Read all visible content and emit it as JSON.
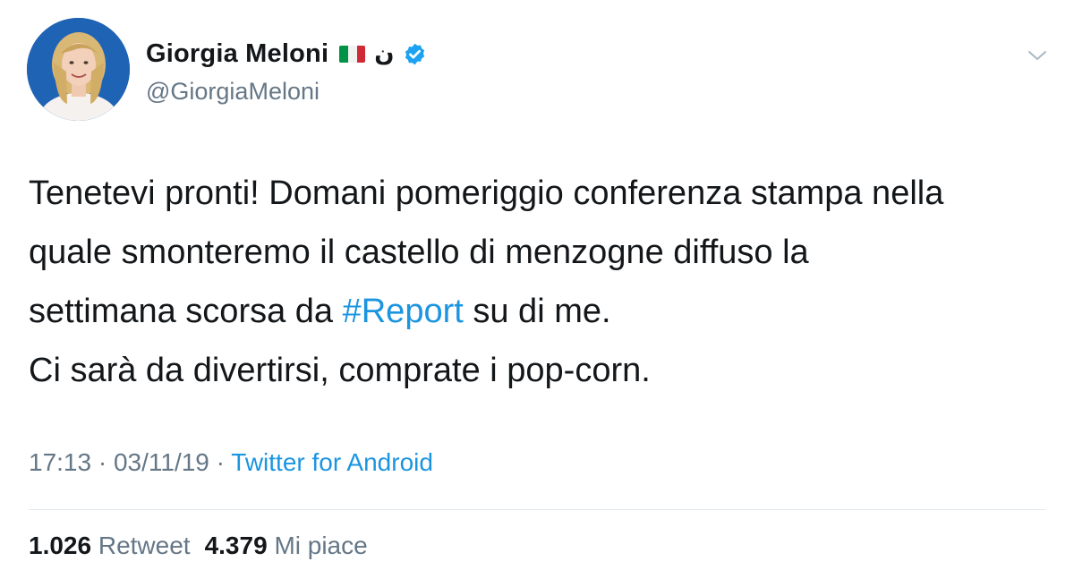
{
  "author": {
    "display_name": "Giorgia Meloni",
    "arabic_char": "ن",
    "handle": "@GiorgiaMeloni",
    "flag_colors": [
      "#009246",
      "#ffffff",
      "#ce2b37"
    ],
    "verified_color": "#1da1f2"
  },
  "tweet": {
    "line1": "Tenetevi pronti! Domani pomeriggio conferenza stampa nella",
    "line2": "quale smonteremo il castello di menzogne diffuso la",
    "line3_pre": "settimana scorsa da ",
    "hashtag": "#Report",
    "line3_post": " su di me.",
    "line4": "Ci sarà da divertirsi, comprate i pop-corn."
  },
  "meta": {
    "time": "17:13",
    "separator1": " · ",
    "date": "03/11/19",
    "separator2": " · ",
    "source": "Twitter for Android"
  },
  "stats": {
    "retweets_count": "1.026",
    "retweets_label": "Retweet",
    "likes_count": "4.379",
    "likes_label": "Mi piace"
  },
  "icons": {
    "verified": "verified-badge-icon",
    "chevron": "chevron-down-icon",
    "flag": "italy-flag-icon"
  },
  "colors": {
    "link": "#1b95e0",
    "secondary_text": "#657786",
    "primary_text": "#14171a"
  }
}
